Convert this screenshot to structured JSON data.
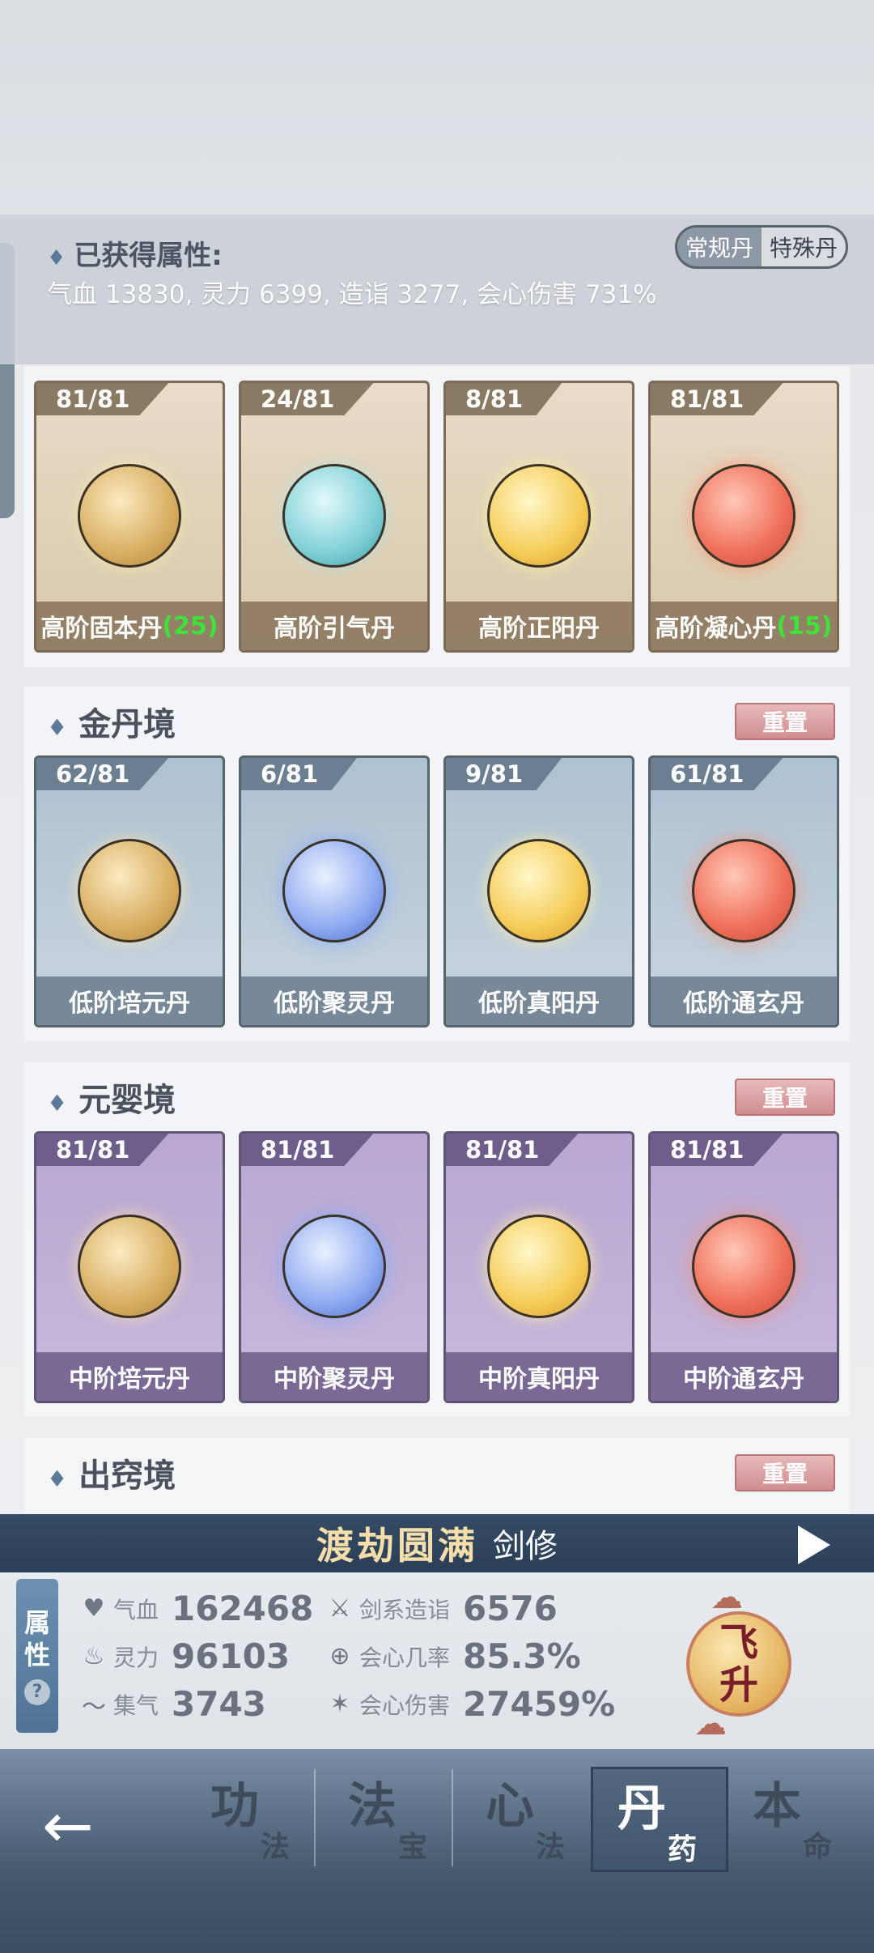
{
  "header": {
    "attr_title": "已获得属性:",
    "attr_values": "气血 13830, 灵力 6399, 造诣 3277, 会心伤害 731%",
    "toggle": [
      "常规丹",
      "特殊丹"
    ]
  },
  "top_cards": [
    {
      "count": "81/81",
      "name": "高阶固本丹",
      "bonus": "(25)"
    },
    {
      "count": "24/81",
      "name": "高阶引气丹",
      "bonus": ""
    },
    {
      "count": "8/81",
      "name": "高阶正阳丹",
      "bonus": ""
    },
    {
      "count": "81/81",
      "name": "高阶凝心丹",
      "bonus": "(15)"
    }
  ],
  "sections": [
    {
      "title": "金丹境",
      "reset": "重置",
      "cards": [
        {
          "count": "62/81",
          "name": "低阶培元丹"
        },
        {
          "count": "6/81",
          "name": "低阶聚灵丹"
        },
        {
          "count": "9/81",
          "name": "低阶真阳丹"
        },
        {
          "count": "61/81",
          "name": "低阶通玄丹"
        }
      ]
    },
    {
      "title": "元婴境",
      "reset": "重置",
      "cards": [
        {
          "count": "81/81",
          "name": "中阶培元丹"
        },
        {
          "count": "81/81",
          "name": "中阶聚灵丹"
        },
        {
          "count": "81/81",
          "name": "中阶真阳丹"
        },
        {
          "count": "81/81",
          "name": "中阶通玄丹"
        }
      ]
    },
    {
      "title": "出窍境",
      "reset": "重置"
    }
  ],
  "realm": {
    "name": "渡劫圆满",
    "school": "剑修"
  },
  "stats_tab": {
    "label_1": "属",
    "label_2": "性",
    "help": "?"
  },
  "stats": [
    {
      "icon": "heart-icon",
      "label": "气血",
      "value": "162468"
    },
    {
      "icon": "flame-icon",
      "label": "灵力",
      "value": "96103"
    },
    {
      "icon": "swirl-icon",
      "label": "集气",
      "value": "3743"
    },
    {
      "icon": "sword-icon",
      "label": "剑系造诣",
      "value": "6576"
    },
    {
      "icon": "target-icon",
      "label": "会心几率",
      "value": "85.3%"
    },
    {
      "icon": "burst-icon",
      "label": "会心伤害",
      "value": "27459%"
    }
  ],
  "ascend": {
    "line1": "飞",
    "line2": "升"
  },
  "nav": [
    {
      "big": "功",
      "small": "法"
    },
    {
      "big": "法",
      "small": "宝"
    },
    {
      "big": "心",
      "small": "法"
    },
    {
      "big": "丹",
      "small": "药"
    },
    {
      "big": "本",
      "small": "命"
    }
  ],
  "colors": {
    "accent": "#354c66",
    "bonus": "#3fe23a",
    "reset": "#cf8d90"
  }
}
